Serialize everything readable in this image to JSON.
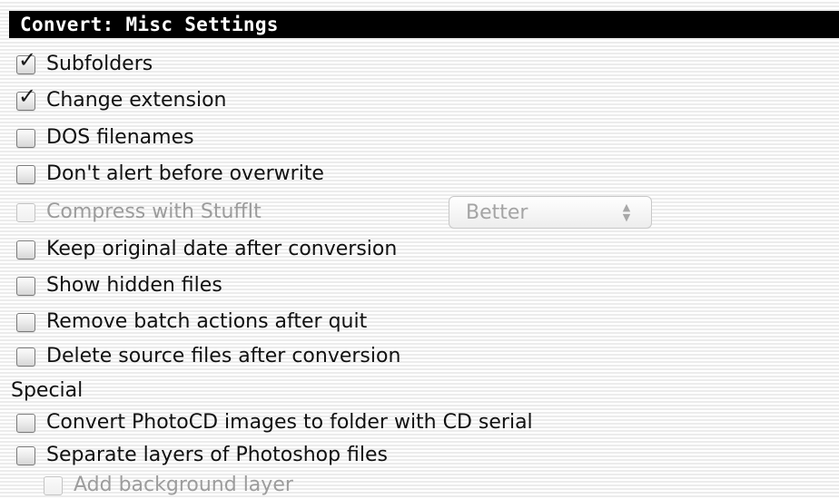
{
  "panel": {
    "title": "Convert: Misc Settings"
  },
  "options": [
    {
      "label": "Subfolders",
      "checked": true,
      "enabled": true
    },
    {
      "label": "Change extension",
      "checked": true,
      "enabled": true
    },
    {
      "label": "DOS filenames",
      "checked": false,
      "enabled": true
    },
    {
      "label": "Don't alert before overwrite",
      "checked": false,
      "enabled": true
    },
    {
      "label": "Compress with StuffIt",
      "checked": false,
      "enabled": false
    },
    {
      "label": "Keep original date after conversion",
      "checked": false,
      "enabled": true
    },
    {
      "label": "Show hidden files",
      "checked": false,
      "enabled": true
    },
    {
      "label": "Remove batch actions after quit",
      "checked": false,
      "enabled": true
    },
    {
      "label": "Delete source files after conversion",
      "checked": false,
      "enabled": true
    }
  ],
  "compression_popup": {
    "value": "Better",
    "enabled": false,
    "arrows_icon": "updown-arrows-icon"
  },
  "special": {
    "heading": "Special",
    "options": [
      {
        "label": "Convert PhotoCD images to folder with CD serial",
        "checked": false,
        "enabled": true
      },
      {
        "label": "Separate layers of Photoshop files",
        "checked": false,
        "enabled": true
      },
      {
        "label": "Add background layer",
        "checked": false,
        "enabled": false
      }
    ]
  },
  "check_glyph": "✓",
  "colors": {
    "title_bar_bg": "#000000",
    "title_bar_text": "#ffffff",
    "disabled_text": "#9c9c9c"
  }
}
